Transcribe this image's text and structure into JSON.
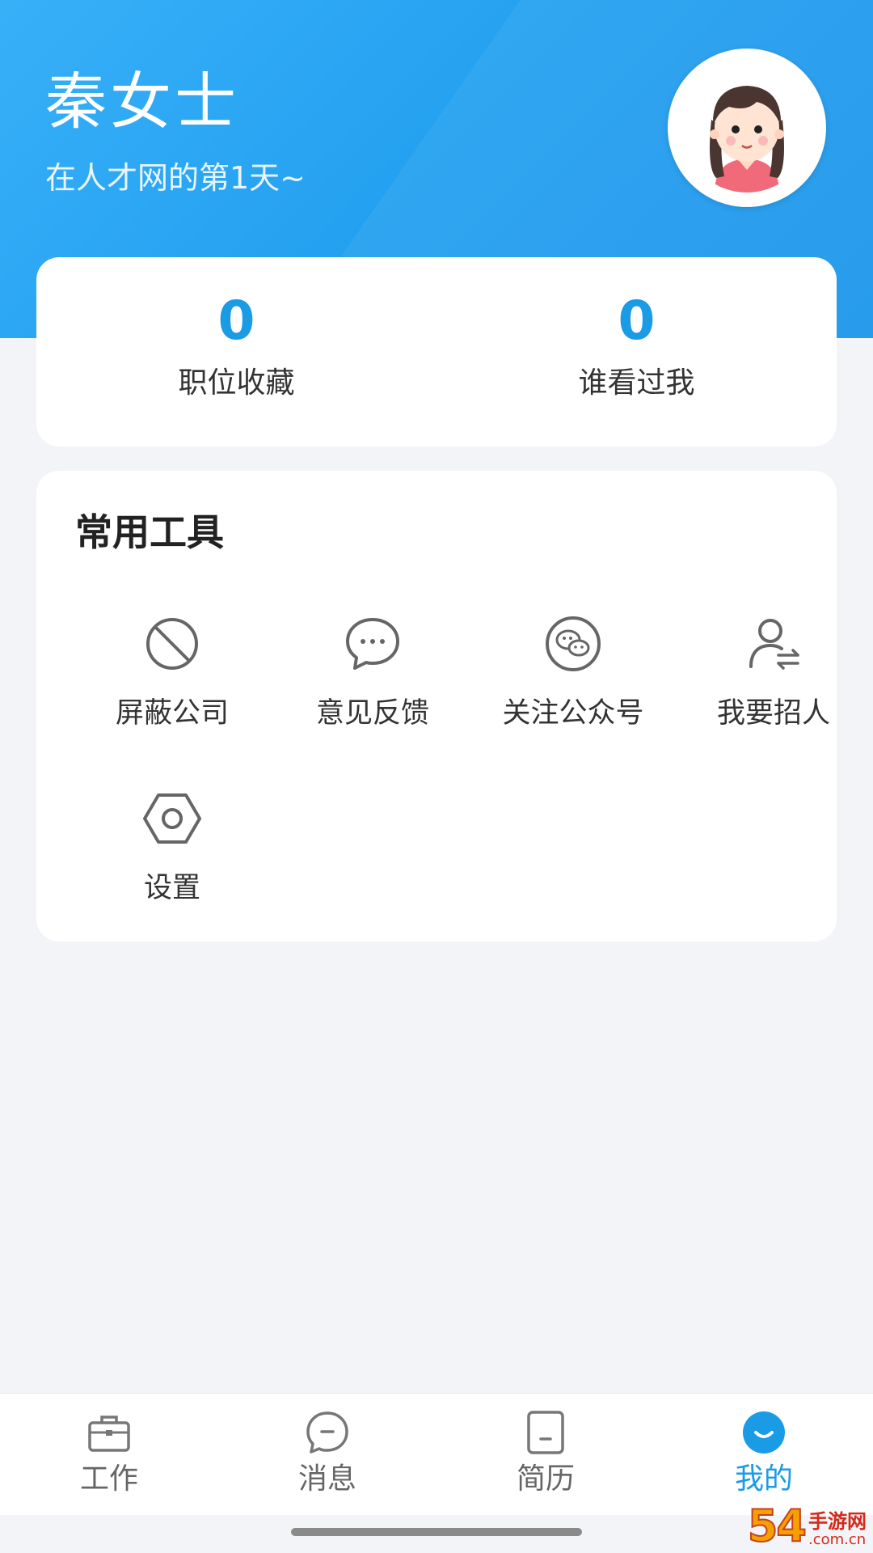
{
  "header": {
    "user_name": "秦女士",
    "subtitle": "在人才网的第1天~",
    "avatar_icon": "girl-avatar-icon"
  },
  "stats": [
    {
      "value": "0",
      "label": "职位收藏"
    },
    {
      "value": "0",
      "label": "谁看过我"
    }
  ],
  "tools": {
    "title": "常用工具",
    "items": [
      {
        "label": "屏蔽公司",
        "icon": "block-icon"
      },
      {
        "label": "意见反馈",
        "icon": "chat-bubble-icon"
      },
      {
        "label": "关注公众号",
        "icon": "wechat-icon"
      },
      {
        "label": "我要招人",
        "icon": "user-switch-icon"
      },
      {
        "label": "设置",
        "icon": "hex-nut-settings-icon"
      }
    ]
  },
  "tabbar": {
    "items": [
      {
        "label": "工作",
        "icon": "briefcase-icon",
        "active": false
      },
      {
        "label": "消息",
        "icon": "message-icon",
        "active": false
      },
      {
        "label": "简历",
        "icon": "resume-icon",
        "active": false
      },
      {
        "label": "我的",
        "icon": "smile-icon",
        "active": true
      }
    ]
  },
  "colors": {
    "accent": "#1a9be6",
    "header_gradient_start": "#38b0f8",
    "header_gradient_end": "#1b95ea",
    "background": "#f2f4f7"
  },
  "watermark": {
    "number": "54",
    "text": "手游网",
    "domain": ".com.cn"
  }
}
